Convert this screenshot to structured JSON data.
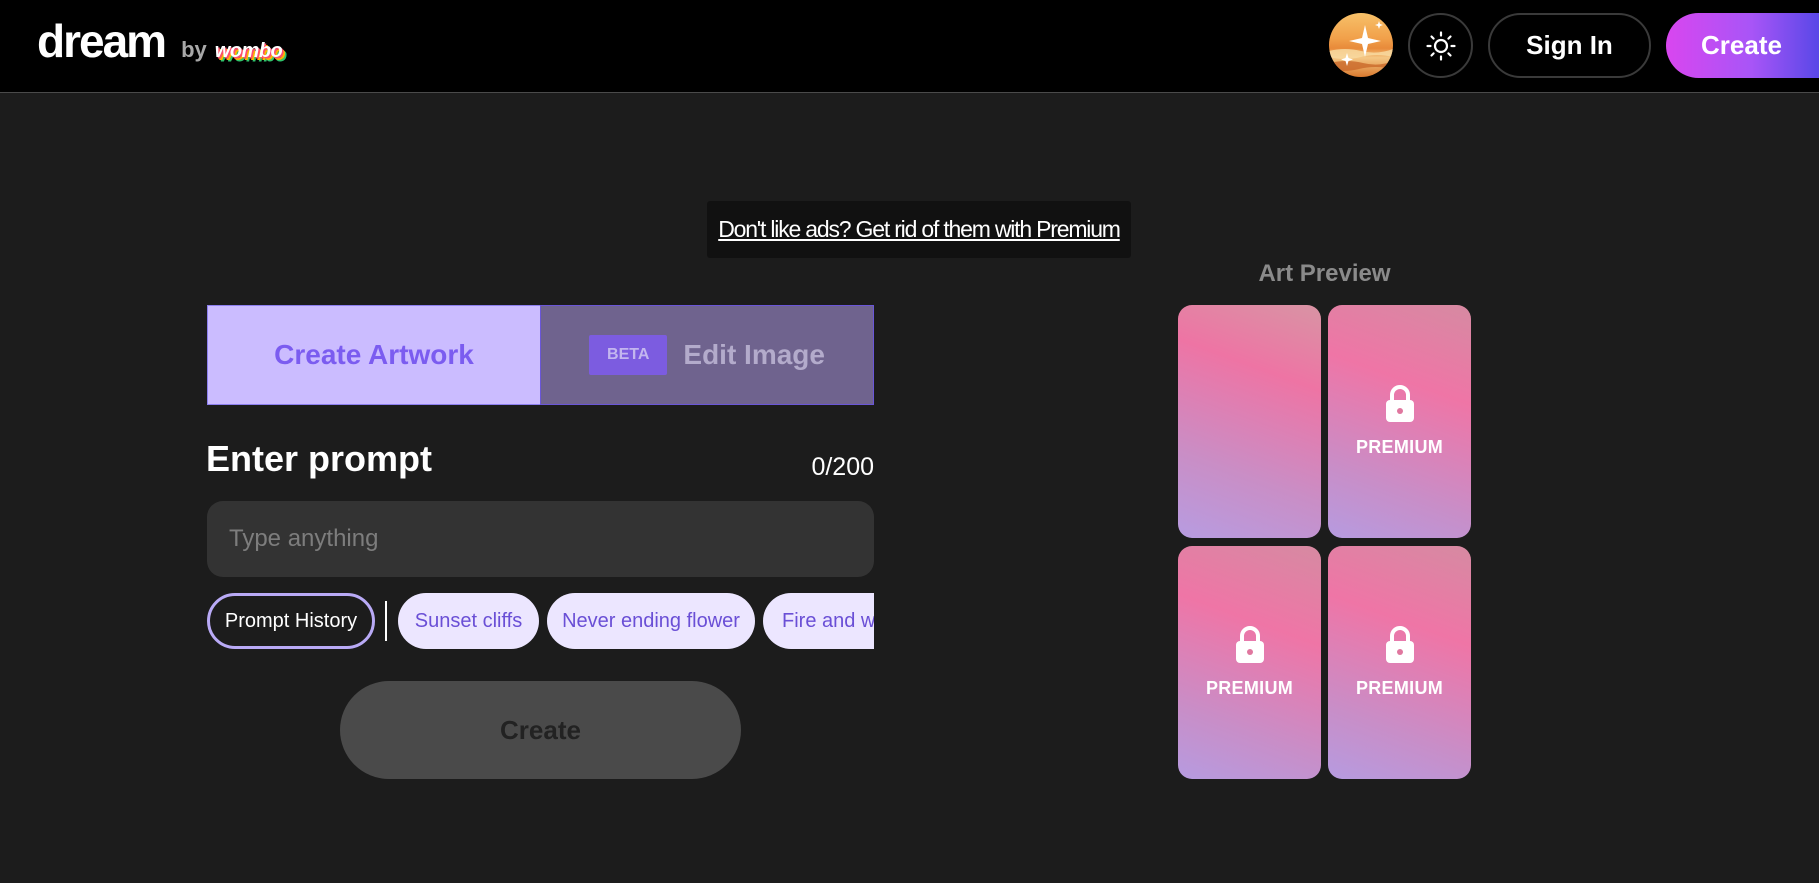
{
  "header": {
    "logo_main": "dream",
    "logo_by": "by",
    "logo_brand": "wombo",
    "signin_label": "Sign In",
    "create_label": "Create"
  },
  "ad": {
    "text": "Don't like ads? Get rid of them with Premium"
  },
  "tabs": {
    "create_artwork": "Create Artwork",
    "beta_badge": "BETA",
    "edit_image": "Edit Image"
  },
  "prompt": {
    "label": "Enter prompt",
    "count": "0/200",
    "value": "",
    "placeholder": "Type anything"
  },
  "chips": {
    "history": "Prompt History",
    "items": [
      "Sunset cliffs",
      "Never ending flower",
      "Fire and water"
    ]
  },
  "create_button": "Create",
  "preview": {
    "title": "Art Preview",
    "cards": [
      {
        "locked": false,
        "label": ""
      },
      {
        "locked": true,
        "label": "PREMIUM"
      },
      {
        "locked": true,
        "label": "PREMIUM"
      },
      {
        "locked": true,
        "label": "PREMIUM"
      }
    ]
  },
  "icons": {
    "avatar": "sparkle-sunset-icon",
    "theme": "sun-icon",
    "lock": "lock-icon"
  },
  "colors": {
    "accent": "#7b5cf0",
    "tab_active_bg": "#cbbcff",
    "tab_inactive_bg": "#6f638e"
  }
}
